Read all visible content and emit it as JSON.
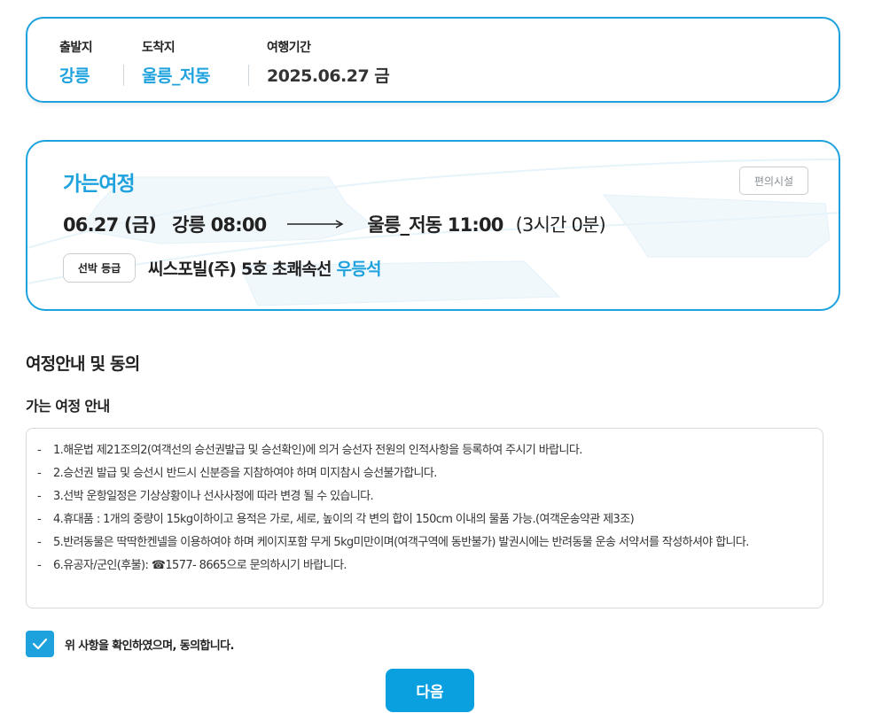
{
  "summary": {
    "departure_label": "출발지",
    "departure_value": "강릉",
    "arrival_label": "도착지",
    "arrival_value": "울릉_저동",
    "period_label": "여행기간",
    "period_value": "2025.06.27 금"
  },
  "journey": {
    "title": "가는여정",
    "amenity_button": "편의시설",
    "date": "06.27 (금)",
    "from": "강릉 08:00",
    "to": "울릉_저동 11:00",
    "duration": "(3시간 0분)",
    "grade_label": "선박 등급",
    "ship_name": "씨스포빌(주) 5호 초쾌속선",
    "seat_class": "우등석"
  },
  "guide": {
    "section_title": "여정안내 및 동의",
    "sub_title": "가는 여정 안내",
    "items": [
      "1.해운법 제21조의2(여객선의 승선권발급 및 승선확인)에 의거 승선자 전원의 인적사항을 등록하여 주시기 바랍니다.",
      "2.승선권 발급 및 승선시 반드시 신분증을 지참하여야 하며 미지참시 승선불가합니다.",
      "3.선박 운항일정은 기상상황이나 선사사정에 따라 변경 될 수 있습니다.",
      "4.휴대품 : 1개의 중량이 15kg이하이고 용적은 가로, 세로, 높이의 각 변의 합이 150cm 이내의 물품 가능.(여객운송약관 제3조)",
      "5.반려동물은 딱딱한켄넬을 이용하여야 하며 케이지포함 무게 5kg미만이며(여객구역에 동반불가) 발권시에는 반려동물 운송 서약서를 작성하셔야 합니다.",
      "6.유공자/군인(후불): ☎1577- 8665으로 문의하시기 바랍니다."
    ],
    "dash": "-"
  },
  "agreement": {
    "checked": true,
    "text": "위 사항을 확인하였으며, 동의합니다."
  },
  "next_button": "다음",
  "colors": {
    "accent": "#1ea2de",
    "button": "#0aa0e0",
    "text": "#222222"
  }
}
